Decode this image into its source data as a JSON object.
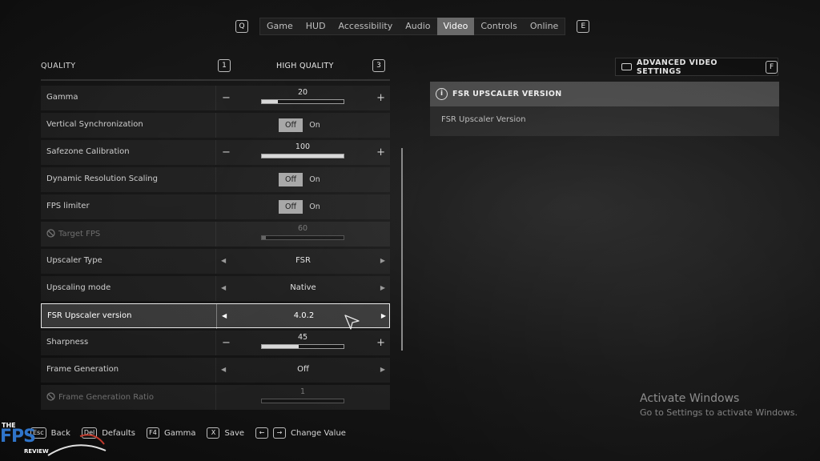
{
  "topnav": {
    "left_key": "Q",
    "right_key": "E",
    "tabs": [
      "Game",
      "HUD",
      "Accessibility",
      "Audio",
      "Video",
      "Controls",
      "Online"
    ],
    "active_tab": "Video"
  },
  "quality": {
    "label": "QUALITY",
    "prev_key": "1",
    "value": "HIGH QUALITY",
    "next_key": "3"
  },
  "settings": [
    {
      "label": "Gamma",
      "type": "slider",
      "value": "20",
      "fill": 0.2,
      "disabled": false
    },
    {
      "label": "Vertical Synchronization",
      "type": "toggle",
      "off": "Off",
      "on": "On",
      "disabled": false
    },
    {
      "label": "Safezone Calibration",
      "type": "slider",
      "value": "100",
      "fill": 1.0,
      "disabled": false
    },
    {
      "label": "Dynamic Resolution Scaling",
      "type": "toggle",
      "off": "Off",
      "on": "On",
      "disabled": false
    },
    {
      "label": "FPS limiter",
      "type": "toggle",
      "off": "Off",
      "on": "On",
      "disabled": false
    },
    {
      "label": "Target FPS",
      "type": "slider",
      "value": "60",
      "fill": 0.05,
      "disabled": true
    },
    {
      "label": "Upscaler Type",
      "type": "select",
      "value": "FSR",
      "disabled": false
    },
    {
      "label": "Upscaling mode",
      "type": "select",
      "value": "Native",
      "disabled": false
    },
    {
      "label": "FSR Upscaler version",
      "type": "select",
      "value": "4.0.2",
      "disabled": false,
      "selected": true
    },
    {
      "label": "Sharpness",
      "type": "slider",
      "value": "45",
      "fill": 0.45,
      "disabled": false
    },
    {
      "label": "Frame Generation",
      "type": "select",
      "value": "Off",
      "disabled": false
    },
    {
      "label": "Frame Generation Ratio",
      "type": "slider",
      "value": "1",
      "fill": 0.0,
      "disabled": true
    }
  ],
  "advanced": {
    "label": "ADVANCED VIDEO SETTINGS",
    "key": "F"
  },
  "info": {
    "title": "FSR UPSCALER VERSION",
    "text": "FSR Upscaler Version"
  },
  "hints": [
    {
      "key": "Esc",
      "label": "Back"
    },
    {
      "key": "Del",
      "label": "Defaults"
    },
    {
      "key": "F4",
      "label": "Gamma"
    },
    {
      "key": "X",
      "label": "Save"
    },
    {
      "key": "←",
      "label": ""
    },
    {
      "key": "→",
      "label": "Change Value"
    }
  ],
  "watermark": {
    "line1": "Activate Windows",
    "line2": "Go to Settings to activate Windows."
  },
  "logo": {
    "the": "THE",
    "fps": "FPS",
    "review": "REVIEW"
  },
  "colors": {
    "active_tab": "#6a6a6a",
    "toggle_off": "#a8a8a8",
    "logo_blue": "#2f74c9"
  }
}
